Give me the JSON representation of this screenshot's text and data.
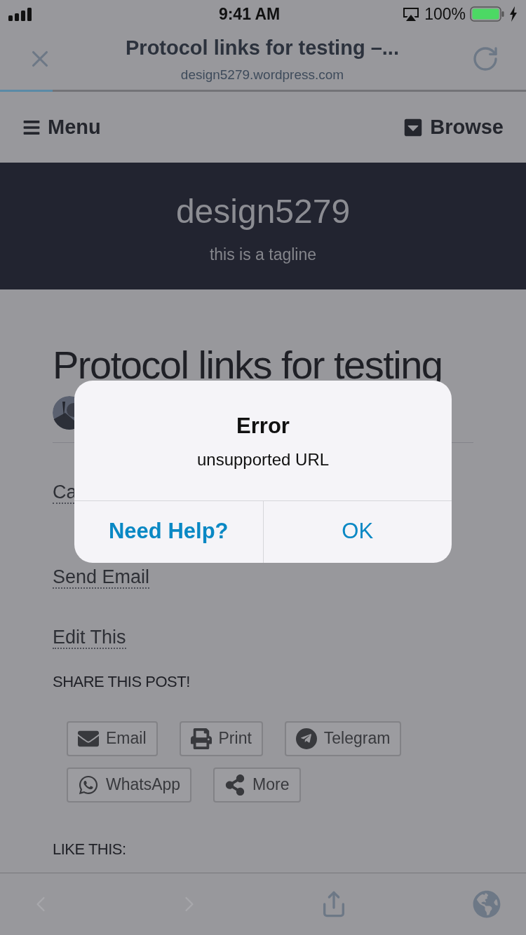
{
  "status_bar": {
    "time": "9:41 AM",
    "battery": "100%"
  },
  "browser_bar": {
    "title": "Protocol links for testing –...",
    "url": "design5279.wordpress.com",
    "progress": {
      "level": 0.1
    }
  },
  "site_nav": {
    "menu": "Menu",
    "browse": "Browse"
  },
  "header": {
    "site_title": "design5279",
    "tagline": "this is a tagline"
  },
  "post": {
    "title": "Protocol links for testing",
    "links": [
      "Ca",
      "Send Email",
      "Edit This"
    ],
    "share_heading": "SHARE THIS POST!",
    "share_buttons": [
      {
        "kind": "email",
        "label": "Email"
      },
      {
        "kind": "print",
        "label": "Print"
      },
      {
        "kind": "telegram",
        "label": "Telegram"
      },
      {
        "kind": "whatsapp",
        "label": "WhatsApp"
      },
      {
        "kind": "more",
        "label": "More"
      }
    ],
    "like_heading": "LIKE THIS:"
  },
  "toolbar": {
    "back": {
      "disabled": true
    },
    "forward": {
      "disabled": true
    }
  },
  "alert": {
    "title": "Error",
    "message": "unsupported URL",
    "buttons": [
      {
        "label": "Need Help?",
        "bold": true
      },
      {
        "label": "OK",
        "bold": false
      }
    ]
  }
}
